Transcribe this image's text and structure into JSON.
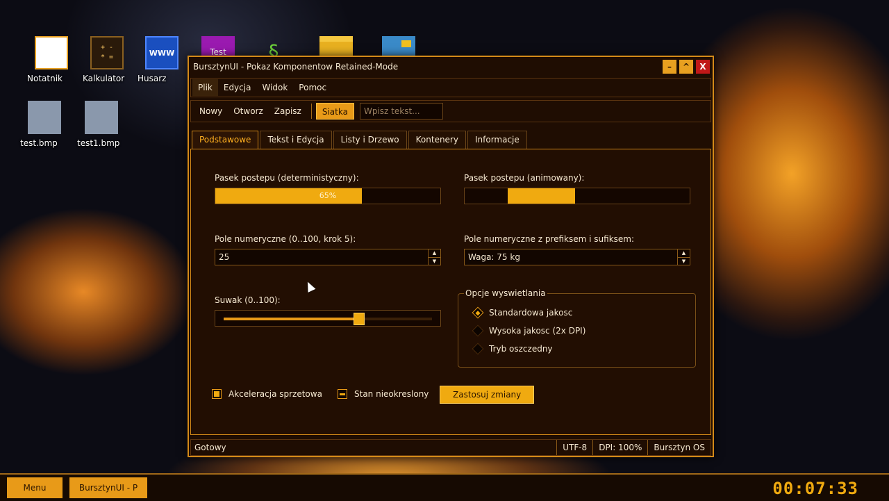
{
  "desktop": {
    "icons": [
      {
        "label": "Notatnik",
        "icon": "notepad-icon"
      },
      {
        "label": "Kalkulator",
        "icon": "calculator-icon",
        "glyph_top": "+ -",
        "glyph_bottom": "* ="
      },
      {
        "label": "Husarz",
        "icon": "browser-icon",
        "glyph": "WWW"
      },
      {
        "label": "",
        "icon": "test-app-icon",
        "glyph": "Test"
      },
      {
        "label": "",
        "icon": "snake-icon",
        "glyph": "§"
      },
      {
        "label": "",
        "icon": "folder-icon"
      },
      {
        "label": "",
        "icon": "image-viewer-icon"
      },
      {
        "label": "test.bmp",
        "icon": "bitmap-file-icon"
      },
      {
        "label": "test1.bmp",
        "icon": "bitmap-file-icon"
      }
    ]
  },
  "window": {
    "title": "BursztynUI - Pokaz Komponentow Retained-Mode",
    "controls": {
      "minimize": "–",
      "maximize": "^",
      "close": "X"
    },
    "menu": [
      "Plik",
      "Edycja",
      "Widok",
      "Pomoc"
    ],
    "toolbar": {
      "buttons": [
        "Nowy",
        "Otworz",
        "Zapisz"
      ],
      "toggle": "Siatka",
      "input_placeholder": "Wpisz tekst..."
    },
    "tabs": [
      "Podstawowe",
      "Tekst i Edycja",
      "Listy i Drzewo",
      "Kontenery",
      "Informacje"
    ],
    "active_tab": "Podstawowe",
    "panel": {
      "progress_det": {
        "label": "Pasek postepu (deterministyczny):",
        "value": 0.65,
        "text": "65%"
      },
      "progress_anim": {
        "label": "Pasek postepu (animowany):",
        "seg_start": 0.19,
        "seg_end": 0.49
      },
      "spin1": {
        "label": "Pole numeryczne (0..100, krok 5):",
        "value": "25"
      },
      "spin2": {
        "label": "Pole numeryczne z prefiksem i sufiksem:",
        "value": "Waga: 75 kg"
      },
      "slider": {
        "label": "Suwak (0..100):",
        "value": 65
      },
      "group": {
        "title": "Opcje wyswietlania",
        "options": [
          "Standardowa jakosc",
          "Wysoka jakosc (2x DPI)",
          "Tryb oszczedny"
        ],
        "selected": 0
      },
      "check_accel": {
        "label": "Akceleracja sprzetowa",
        "state": "checked"
      },
      "check_indet": {
        "label": "Stan nieokreslony",
        "state": "indeterminate"
      },
      "apply_label": "Zastosuj zmiany"
    },
    "status": {
      "text": "Gotowy",
      "encoding": "UTF-8",
      "dpi": "DPI: 100%",
      "os": "Bursztyn OS"
    }
  },
  "taskbar": {
    "start_label": "Menu",
    "task_label": "BursztynUI - P",
    "clock": "00:07:33"
  },
  "colors": {
    "accent": "#f0aa10",
    "border": "#d48a18",
    "window_bg": "#1f0d02",
    "close": "#c01818"
  }
}
